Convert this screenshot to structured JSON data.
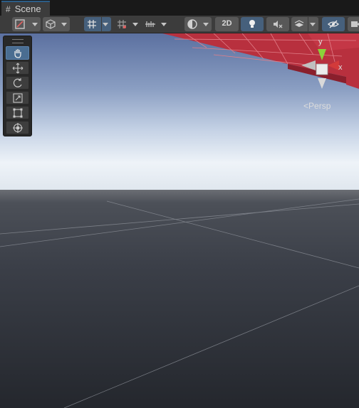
{
  "window": {
    "tab_label": "Scene",
    "tab_icon": "grid-icon"
  },
  "toolbar": {
    "draw_mode_icon": "shaded-draw-mode-icon",
    "render_mode_icon": "cube-render-icon",
    "grid_toggle_icon": "grid-toggle-icon",
    "snap_icon": "increment-snap-icon",
    "ruler_icon": "ruler-icon",
    "view_sphere_icon": "sphere-view-icon",
    "mode_2d_label": "2D",
    "lighting_icon": "lightbulb-icon",
    "audio_icon": "audio-mute-icon",
    "effects_icon": "effects-layers-icon",
    "visibility_icon": "hidden-eye-icon",
    "camera_icon": "camera-icon"
  },
  "tools_overlay": {
    "items": [
      {
        "name": "view-tool",
        "icon": "hand-icon",
        "selected": true
      },
      {
        "name": "move-tool",
        "icon": "move-arrows-icon",
        "selected": false
      },
      {
        "name": "rotate-tool",
        "icon": "rotate-icon",
        "selected": false
      },
      {
        "name": "scale-tool",
        "icon": "scale-icon",
        "selected": false
      },
      {
        "name": "rect-tool",
        "icon": "rect-icon",
        "selected": false
      },
      {
        "name": "transform-tool",
        "icon": "transform-icon",
        "selected": false
      }
    ]
  },
  "gizmo": {
    "y_label": "y",
    "x_label": "x",
    "projection_label": "Persp"
  },
  "colors": {
    "sky_top": "#5e73a0",
    "horizon": "#e6eef5",
    "ground": "#3a3e47",
    "mesh": "#b8303e",
    "accent": "#46607c"
  }
}
